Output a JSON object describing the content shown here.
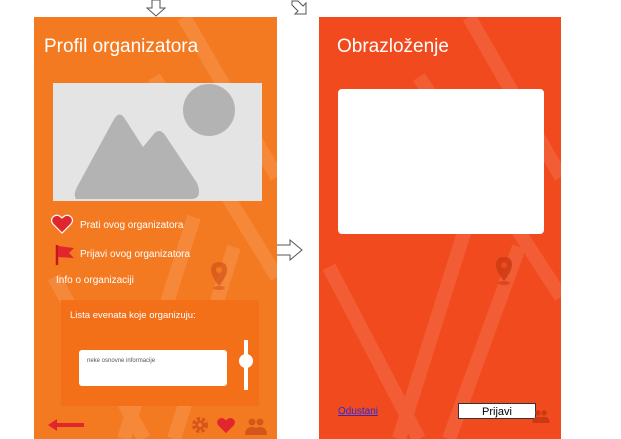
{
  "left_screen": {
    "title": "Profil organizatora",
    "follow_label": "Prati ovog organizatora",
    "report_label": "Prijavi ovog organizatora",
    "info_label": "Info o organizaciji",
    "events": {
      "title": "Lista evenata koje organizuju:",
      "card_text": "neke osnovne informacije"
    },
    "icons": {
      "image": "image-placeholder-icon",
      "follow": "heart-icon",
      "report": "flag-icon",
      "location": "map-pin-icon",
      "back": "back-arrow-icon",
      "settings": "gear-icon",
      "favorites": "heart-icon",
      "people": "people-icon"
    }
  },
  "right_screen": {
    "title": "Obrazloženje",
    "cancel_label": "Odustani",
    "submit_label": "Prijavi",
    "icons": {
      "location": "map-pin-icon"
    }
  },
  "flow_arrows": [
    "arrow-down-icon",
    "arrow-down-right-icon",
    "arrow-right-icon"
  ],
  "colors": {
    "left_screen_bg": "#f47a22",
    "right_screen_bg": "#f24a1f",
    "events_box_bg": "#f36f18",
    "heart_red": "#e2262d",
    "back_arrow_red": "#e2262d",
    "placeholder_gray": "#b3b3b3"
  }
}
